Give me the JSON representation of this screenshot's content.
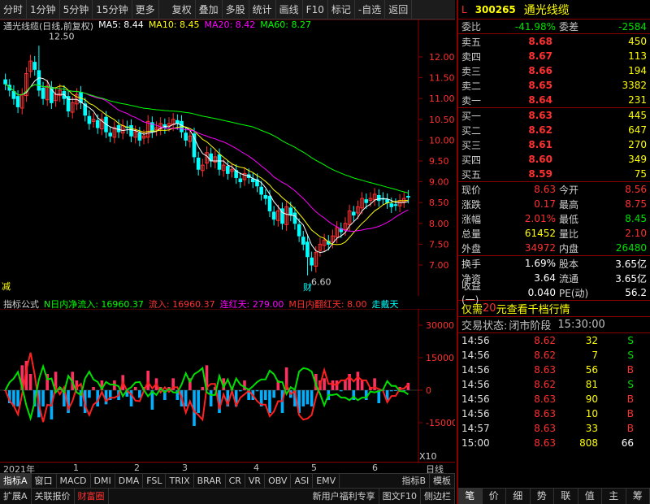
{
  "toolbar": {
    "items": [
      "分时",
      "1分钟",
      "5分钟",
      "15分钟",
      "更多",
      "复权",
      "叠加",
      "多股",
      "统计",
      "画线",
      "F10",
      "标记",
      "-自选",
      "返回"
    ]
  },
  "main_chart": {
    "title": "通光线缆(日线,前复权)",
    "ma": [
      {
        "label": "MA5: 8.44",
        "color": "#ffffff"
      },
      {
        "label": "MA10: 8.45",
        "color": "#ffff00"
      },
      {
        "label": "MA20: 8.42",
        "color": "#ff00ff"
      },
      {
        "label": "MA60: 8.27",
        "color": "#00ff00"
      }
    ],
    "high_label": "12.50",
    "low_label": "6.60",
    "y_ticks": [
      "12.00",
      "11.50",
      "11.00",
      "10.50",
      "10.00",
      "9.50",
      "9.00",
      "8.50",
      "8.00",
      "7.50",
      "7.00"
    ],
    "left_marker": "减",
    "fin_marker": "财"
  },
  "indicator": {
    "name": "指标公式",
    "items": [
      {
        "label": "N日内净流入: 16960.37",
        "color": "#00ff00"
      },
      {
        "label": "流入: 16960.37",
        "color": "#ff3030"
      },
      {
        "label": "连红天: 279.00",
        "color": "#ff00ff"
      },
      {
        "label": "M日内翻红天: 8.00",
        "color": "#ff3030"
      },
      {
        "label": "走戴天",
        "color": "#00ffff"
      }
    ],
    "y_ticks": [
      "30000",
      "15000",
      "0",
      "-15000"
    ],
    "scale_label": "X10"
  },
  "date_axis": {
    "labels": [
      "2021年",
      "1",
      "2",
      "3",
      "4",
      "5",
      "6"
    ],
    "right_label": "日线"
  },
  "tabs": {
    "items": [
      "指标A",
      "窗口",
      "MACD",
      "DMI",
      "DMA",
      "FSL",
      "TRIX",
      "BRAR",
      "CR",
      "VR",
      "OBV",
      "ASI",
      "EMV"
    ],
    "right": [
      "指标B",
      "模板"
    ]
  },
  "bottom_bar": {
    "items": [
      "扩展A",
      "关联报价",
      "财富圈"
    ],
    "right": [
      "新用户福利专享",
      "图文F10",
      "侧边栏"
    ]
  },
  "quote": {
    "market": "L",
    "code": "300265",
    "name": "通光线缆",
    "weibi_label": "委比",
    "weibi_value": "-41.98%",
    "weicha_label": "委差",
    "weicha_value": "-2584",
    "asks": [
      {
        "label": "卖五",
        "price": "8.68",
        "vol": "450"
      },
      {
        "label": "卖四",
        "price": "8.67",
        "vol": "113"
      },
      {
        "label": "卖三",
        "price": "8.66",
        "vol": "194"
      },
      {
        "label": "卖二",
        "price": "8.65",
        "vol": "3382"
      },
      {
        "label": "卖一",
        "price": "8.64",
        "vol": "231"
      }
    ],
    "bids": [
      {
        "label": "买一",
        "price": "8.63",
        "vol": "445"
      },
      {
        "label": "买二",
        "price": "8.62",
        "vol": "647"
      },
      {
        "label": "买三",
        "price": "8.61",
        "vol": "270"
      },
      {
        "label": "买四",
        "price": "8.60",
        "vol": "349"
      },
      {
        "label": "买五",
        "price": "8.59",
        "vol": "75"
      }
    ],
    "stats1": [
      {
        "l1": "现价",
        "v1": "8.63",
        "c1": "red",
        "l2": "今开",
        "v2": "8.56",
        "c2": "red"
      },
      {
        "l1": "涨跌",
        "v1": "0.17",
        "c1": "red",
        "l2": "最高",
        "v2": "8.75",
        "c2": "red"
      },
      {
        "l1": "涨幅",
        "v1": "2.01%",
        "c1": "red",
        "l2": "最低",
        "v2": "8.45",
        "c2": "green"
      },
      {
        "l1": "总量",
        "v1": "61452",
        "c1": "yellow",
        "l2": "量比",
        "v2": "2.10",
        "c2": "red"
      },
      {
        "l1": "外盘",
        "v1": "34972",
        "c1": "red",
        "l2": "内盘",
        "v2": "26480",
        "c2": "green"
      }
    ],
    "stats2": [
      {
        "l1": "换手",
        "v1": "1.69%",
        "c1": "white",
        "l2": "股本",
        "v2": "3.65亿",
        "c2": "white"
      },
      {
        "l1": "净资",
        "v1": "3.64",
        "c1": "white",
        "l2": "流通",
        "v2": "3.65亿",
        "c2": "white"
      },
      {
        "l1": "收益(一)",
        "v1": "0.040",
        "c1": "white",
        "l2": "PE(动)",
        "v2": "56.2",
        "c2": "white"
      }
    ],
    "promo_prefix": "仅需",
    "promo_amount": "20",
    "promo_suffix": "元查看千档行情",
    "status_label": "交易状态:",
    "status_value": "闭市阶段",
    "status_time": "15:30:00",
    "ticks": [
      {
        "t": "14:56",
        "p": "8.62",
        "pc": "red",
        "q": "32",
        "d": "S",
        "dc": "green"
      },
      {
        "t": "14:56",
        "p": "8.62",
        "pc": "red",
        "q": "7",
        "d": "S",
        "dc": "green"
      },
      {
        "t": "14:56",
        "p": "8.63",
        "pc": "red",
        "q": "56",
        "d": "B",
        "dc": "red"
      },
      {
        "t": "14:56",
        "p": "8.62",
        "pc": "red",
        "q": "81",
        "d": "S",
        "dc": "green"
      },
      {
        "t": "14:56",
        "p": "8.63",
        "pc": "red",
        "q": "90",
        "d": "B",
        "dc": "red"
      },
      {
        "t": "14:56",
        "p": "8.63",
        "pc": "red",
        "q": "10",
        "d": "B",
        "dc": "red"
      },
      {
        "t": "14:57",
        "p": "8.63",
        "pc": "red",
        "q": "33",
        "d": "B",
        "dc": "red"
      },
      {
        "t": "15:00",
        "p": "8.63",
        "pc": "red",
        "q": "808",
        "qc": "magenta",
        "d": "66",
        "dc": "white"
      }
    ],
    "tabs": [
      "笔",
      "价",
      "细",
      "势",
      "联",
      "值",
      "主",
      "筹"
    ]
  },
  "colors": {
    "up": "#ff3030",
    "down": "#00e000",
    "panel_border": "#8b0000"
  }
}
